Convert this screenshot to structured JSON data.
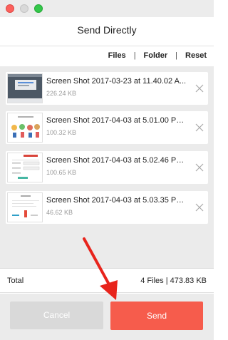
{
  "window": {
    "title": "Send Directly"
  },
  "actions": {
    "files": "Files",
    "folder": "Folder",
    "reset": "Reset",
    "separator": "|"
  },
  "files": [
    {
      "name": "Screen Shot 2017-03-23 at 11.40.02 A...",
      "size": "226.24 KB"
    },
    {
      "name": "Screen Shot 2017-04-03 at 5.01.00 PM....",
      "size": "100.32 KB"
    },
    {
      "name": "Screen Shot 2017-04-03 at 5.02.46 PM....",
      "size": "100.65 KB"
    },
    {
      "name": "Screen Shot 2017-04-03 at 5.03.35 PM....",
      "size": "46.62 KB"
    }
  ],
  "summary": {
    "label": "Total",
    "value": "4 Files | 473.83 KB"
  },
  "buttons": {
    "cancel": "Cancel",
    "send": "Send"
  },
  "colors": {
    "send": "#f65c4c",
    "cancel": "#d9d9d9",
    "annotation_arrow": "#e8241c"
  }
}
